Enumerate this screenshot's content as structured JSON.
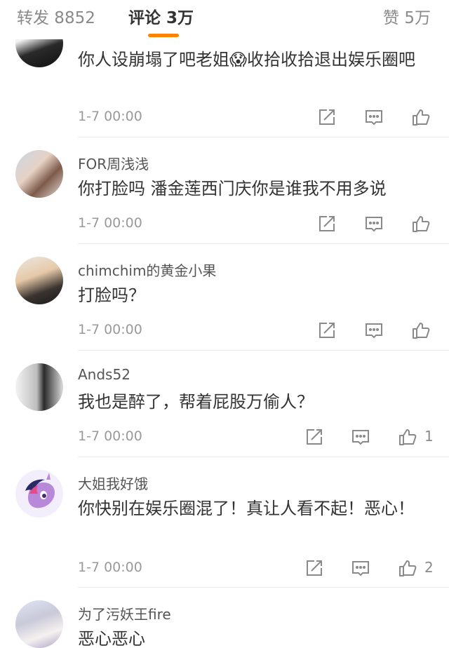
{
  "tabs": {
    "repost": "转发 8852",
    "comments": "评论 3万",
    "likes": "赞 5万"
  },
  "accent_color": "#ff8200",
  "comments": [
    {
      "username": "",
      "text": "你人设崩塌了吧老姐😱收拾收拾退出娱乐圈吧",
      "time": "1-7 00:00",
      "likes": ""
    },
    {
      "username": "FOR周浅浅",
      "text": "你打脸吗 潘金莲西门庆你是谁我不用多说",
      "time": "1-7 00:00",
      "likes": ""
    },
    {
      "username": "chimchim的黄金小果",
      "text": "打脸吗？",
      "time": "1-7 00:00",
      "likes": ""
    },
    {
      "username": "Ands52",
      "text": "我也是醉了，帮着屁股万偷人？",
      "time": "1-7 00:00",
      "likes": "1"
    },
    {
      "username": "大姐我好饿",
      "text": "你快别在娱乐圈混了！真让人看不起！恶心！",
      "time": "1-7 00:00",
      "likes": "2"
    },
    {
      "username": "为了污妖王fire",
      "text": "恶心恶心",
      "time": "",
      "likes": ""
    }
  ]
}
